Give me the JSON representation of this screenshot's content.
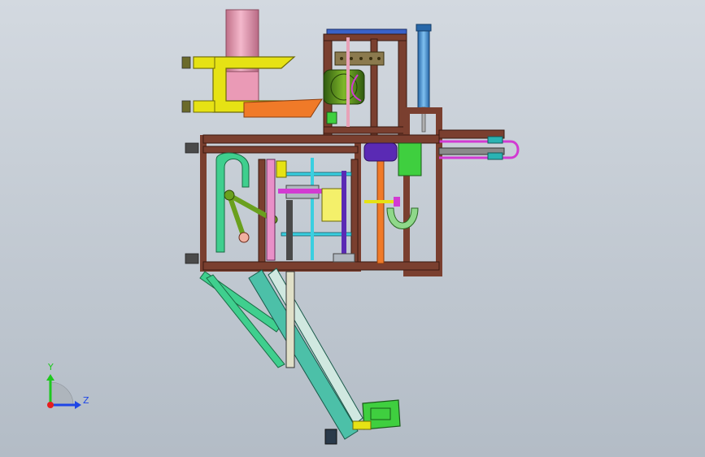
{
  "viewport": {
    "background_top": "#cfd6de",
    "background_bottom": "#b7c0ca"
  },
  "triad": {
    "y_label": "Y",
    "z_label": "Z",
    "y_color": "#1ec81e",
    "z_color": "#1e46e6",
    "x_color": "#e61e1e"
  },
  "model": {
    "frame_color": "#7a3f2f",
    "cylinder_color": "#e8a2b8",
    "yellow_color": "#e6e214",
    "orange_color": "#f07a28",
    "olive_color": "#6aa01e",
    "blue_color": "#3b8fd6",
    "green_color": "#3fcf8e",
    "magenta_color": "#d23ad2",
    "purple_color": "#5a2ab4"
  }
}
